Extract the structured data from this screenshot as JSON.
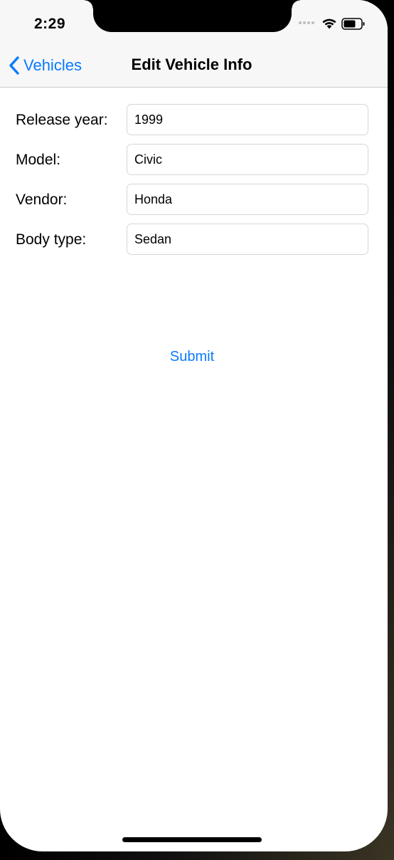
{
  "status_bar": {
    "time": "2:29",
    "wifi_icon": "wifi-icon",
    "battery_icon": "battery-icon"
  },
  "nav": {
    "back_label": "Vehicles",
    "back_icon": "chevron-left-icon",
    "title": "Edit Vehicle Info",
    "accent_color": "#0a7aff"
  },
  "form": {
    "fields": [
      {
        "label": "Release year:",
        "value": "1999"
      },
      {
        "label": "Model:",
        "value": "Civic"
      },
      {
        "label": "Vendor:",
        "value": "Honda"
      },
      {
        "label": "Body type:",
        "value": "Sedan"
      }
    ],
    "submit_label": "Submit"
  }
}
